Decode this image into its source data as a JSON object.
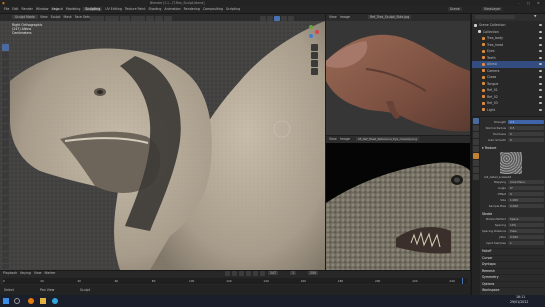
{
  "app": {
    "title": "Blender [C:\\...\\T-Rex_Sculpt.blend]",
    "window_buttons": [
      "-",
      "□",
      "×"
    ]
  },
  "menu": {
    "items": [
      "File",
      "Edit",
      "Render",
      "Window",
      "Help"
    ],
    "workspaces": [
      "Layout",
      "Modeling",
      "Sculpting",
      "UV Editing",
      "Texture Paint",
      "Shading",
      "Animation",
      "Rendering",
      "Compositing",
      "Scripting"
    ],
    "active_workspace": "Sculpting",
    "scene": "Scene",
    "view_layer": "ViewLayer"
  },
  "viewport": {
    "mode": "Sculpt Mode",
    "header_menus": [
      "View",
      "Sculpt",
      "Mask",
      "Face Sets"
    ],
    "overlay_lines": [
      "Right Orthographic",
      "(247) Alkino",
      "Centimeters"
    ],
    "tools": [
      "draw",
      "draw-sharp",
      "clay",
      "clay-strips",
      "clay-thumb",
      "layer",
      "inflate",
      "blob",
      "crease",
      "smooth",
      "flatten",
      "fill",
      "scrape",
      "multiplane-scrape",
      "pinch",
      "grab",
      "elastic-deform",
      "snake-hook",
      "thumb",
      "pose",
      "nudge",
      "rotate",
      "slide-relax",
      "boundary",
      "cloth",
      "simplify",
      "mask",
      "draw-face-sets",
      "box-mask",
      "lasso-mask",
      "box-hide",
      "annotate",
      "transform"
    ],
    "active_tool_index": 0
  },
  "image_editor_top": {
    "title": "Ref_Trex_Sculpt_Side.jpg",
    "menus": [
      "View",
      "Image"
    ]
  },
  "image_editor_bottom": {
    "title": "05_Ref_Head_Reference_Eye_closeUp.png",
    "menus": [
      "View",
      "Image"
    ]
  },
  "timeline": {
    "menus": [
      "Playback",
      "Keying",
      "View",
      "Marker"
    ],
    "frame_marks": [
      "0",
      "20",
      "40",
      "60",
      "80",
      "100",
      "120",
      "140",
      "160",
      "180",
      "200",
      "220",
      "240"
    ],
    "current_frame": 247,
    "start": 1,
    "end": 250
  },
  "outliner": {
    "header": "Scene Collection",
    "items": [
      {
        "label": "Scene Collection",
        "depth": 0
      },
      {
        "label": "Collection",
        "depth": 1
      },
      {
        "label": "Trex_body",
        "depth": 2
      },
      {
        "label": "Trex_head",
        "depth": 2
      },
      {
        "label": "Eyes",
        "depth": 2
      },
      {
        "label": "Teeth",
        "depth": 2
      },
      {
        "label": "Alkino",
        "depth": 2,
        "selected": true
      },
      {
        "label": "Camera",
        "depth": 2
      },
      {
        "label": "Claws",
        "depth": 2
      },
      {
        "label": "Tongue",
        "depth": 2
      },
      {
        "label": "Ref_01",
        "depth": 2
      },
      {
        "label": "Ref_02",
        "depth": 2
      },
      {
        "label": "Ref_03",
        "depth": 2
      },
      {
        "label": "Light",
        "depth": 2
      }
    ]
  },
  "properties": {
    "brush_settings": [
      {
        "label": "Strength",
        "value": "0.5"
      },
      {
        "label": "Normal Radius",
        "value": "0.5"
      },
      {
        "label": "Hardness",
        "value": "0"
      },
      {
        "label": "Auto Smooth",
        "value": "0"
      }
    ],
    "texture_section": "Texture",
    "texture_name": "Alli_detail_scales04",
    "texture_settings": [
      {
        "label": "Mapping",
        "value": "Area Plane"
      },
      {
        "label": "Angle",
        "value": "0°"
      },
      {
        "label": "Offset",
        "value": "0"
      },
      {
        "label": "Size",
        "value": "1.000"
      },
      {
        "label": "Sample Bias",
        "value": "0.000"
      }
    ],
    "stroke_section": "Stroke",
    "stroke_settings": [
      {
        "label": "Stroke Method",
        "value": "Space"
      },
      {
        "label": "Spacing",
        "value": "10%"
      },
      {
        "label": "Spacing Distance",
        "value": "View"
      },
      {
        "label": "Jitter",
        "value": "0.000"
      },
      {
        "label": "Input Samples",
        "value": "1"
      }
    ],
    "options": [
      "Falloff",
      "Cursor",
      "Dyntopo",
      "Remesh",
      "Symmetry",
      "Options",
      "Workspace"
    ]
  },
  "status_bar": {
    "left": "Select",
    "middle": "Pan View",
    "right": "Sculpt"
  },
  "taskbar": {
    "time": "16:11",
    "date": "29/01/2022"
  },
  "colors": {
    "accent": "#4772b3",
    "active_tool": "#4a6aa0",
    "selected_row": "#334d80",
    "sculpt_skin": "#b7ab9a",
    "mask_band": "#3d3a36"
  }
}
